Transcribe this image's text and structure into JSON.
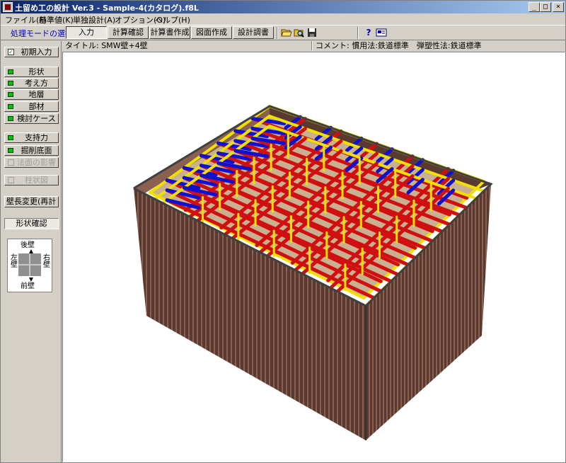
{
  "window": {
    "title": "土留め工の設計 Ver.3 - Sample-4(カタログ).f8L",
    "controls": {
      "minimize": "_",
      "maximize": "□",
      "close": "×"
    }
  },
  "menu": [
    "ファイル(F)",
    "基準値(K)",
    "単独設計(A)",
    "オプション(O)",
    "ヘルプ(H)"
  ],
  "toolbar": {
    "mode_label": "処理モードの選択",
    "buttons": [
      "入力",
      "計算確認",
      "計算書作成",
      "図面作成",
      "設計調書"
    ],
    "active_button": "入力",
    "icons": [
      "open-folder-icon",
      "search-folder-icon",
      "save-icon",
      "help-icon",
      "about-icon"
    ]
  },
  "sidebar": {
    "initial_input": "初期入力",
    "group1": [
      "形状",
      "考え方",
      "地層",
      "部材",
      "検討ケース"
    ],
    "group2": [
      "支持力",
      "掘削底面",
      "法面の影響"
    ],
    "group3": [
      "柱状図"
    ],
    "wall_length_change": "壁長変更(再計算)",
    "shape_confirm": "形状確認",
    "directions": {
      "back": "後壁",
      "front": "前壁",
      "left": "左壁",
      "right": "右壁"
    }
  },
  "info": {
    "title": "タイトル: SMW壁+4壁",
    "comment": "コメント: 慣用法:鉄道標準　弾塑性法:鉄道標準"
  },
  "model": {
    "colors": {
      "wall_dark": "#5a3a30",
      "wall_light": "#8a6050",
      "wale": "#f0e000",
      "strut": "#d01010",
      "brace": "#1010d0",
      "ground": "#c8b090",
      "background": "#ffffff"
    }
  }
}
